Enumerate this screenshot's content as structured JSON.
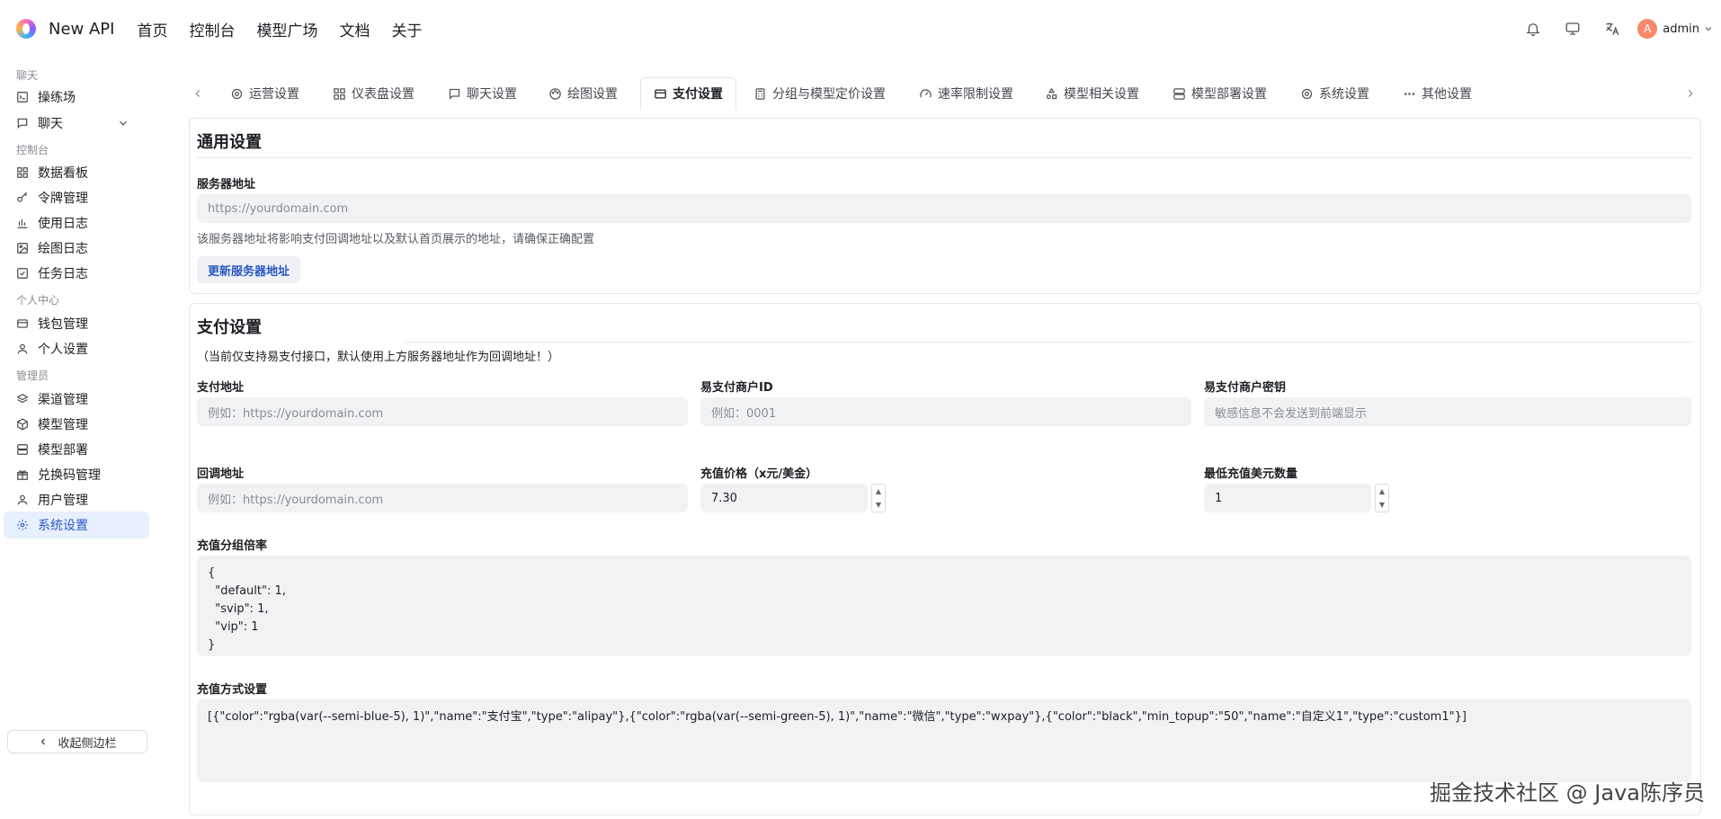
{
  "app": {
    "brand": "New API"
  },
  "nav": {
    "links": [
      "首页",
      "控制台",
      "模型广场",
      "文档",
      "关于"
    ]
  },
  "user": {
    "avatar_letter": "A",
    "name": "admin"
  },
  "sidebar": {
    "groups": [
      {
        "title": "聊天",
        "items": [
          {
            "label": "操练场",
            "icon": "playground-icon"
          },
          {
            "label": "聊天",
            "icon": "chat-icon"
          }
        ]
      },
      {
        "title": "控制台",
        "items": [
          {
            "label": "数据看板",
            "icon": "dashboard-icon"
          },
          {
            "label": "令牌管理",
            "icon": "key-icon"
          },
          {
            "label": "使用日志",
            "icon": "bar-chart-icon"
          },
          {
            "label": "绘图日志",
            "icon": "image-icon"
          },
          {
            "label": "任务日志",
            "icon": "checkbox-icon"
          }
        ]
      },
      {
        "title": "个人中心",
        "items": [
          {
            "label": "钱包管理",
            "icon": "wallet-icon"
          },
          {
            "label": "个人设置",
            "icon": "user-icon"
          }
        ]
      },
      {
        "title": "管理员",
        "items": [
          {
            "label": "渠道管理",
            "icon": "layers-icon"
          },
          {
            "label": "模型管理",
            "icon": "cube-icon"
          },
          {
            "label": "模型部署",
            "icon": "server-icon"
          },
          {
            "label": "兑换码管理",
            "icon": "gift-icon"
          },
          {
            "label": "用户管理",
            "icon": "user-icon"
          },
          {
            "label": "系统设置",
            "icon": "gear-icon"
          }
        ]
      }
    ],
    "collapse_label": "收起侧边栏"
  },
  "tabs": [
    {
      "label": "运营设置",
      "icon": "gear-icon"
    },
    {
      "label": "仪表盘设置",
      "icon": "dashboard-icon"
    },
    {
      "label": "聊天设置",
      "icon": "chat-icon"
    },
    {
      "label": "绘图设置",
      "icon": "palette-icon"
    },
    {
      "label": "支付设置",
      "icon": "card-icon",
      "active": true
    },
    {
      "label": "分组与模型定价设置",
      "icon": "calculator-icon"
    },
    {
      "label": "速率限制设置",
      "icon": "gauge-icon"
    },
    {
      "label": "模型相关设置",
      "icon": "shapes-icon"
    },
    {
      "label": "模型部署设置",
      "icon": "server-icon"
    },
    {
      "label": "系统设置",
      "icon": "gear-icon"
    },
    {
      "label": "其他设置",
      "icon": "more-icon"
    }
  ],
  "general": {
    "title": "通用设置",
    "server_label": "服务器地址",
    "server_placeholder": "https://yourdomain.com",
    "server_hint": "该服务器地址将影响支付回调地址以及默认首页展示的地址，请确保正确配置",
    "update_button": "更新服务器地址"
  },
  "payment": {
    "title": "支付设置",
    "note": "（当前仅支持易支付接口，默认使用上方服务器地址作为回调地址！）",
    "pay_url_label": "支付地址",
    "pay_url_placeholder": "例如：https://yourdomain.com",
    "merchant_id_label": "易支付商户ID",
    "merchant_id_placeholder": "例如：0001",
    "merchant_key_label": "易支付商户密钥",
    "merchant_key_placeholder": "敏感信息不会发送到前端显示",
    "callback_label": "回调地址",
    "callback_placeholder": "例如：https://yourdomain.com",
    "price_label": "充值价格（x元/美金）",
    "price_value": "7.30",
    "min_topup_label": "最低充值美元数量",
    "min_topup_value": "1",
    "group_ratio_label": "充值分组倍率",
    "group_ratio_value": "{\n  \"default\": 1,\n  \"svip\": 1,\n  \"vip\": 1\n}",
    "methods_label": "充值方式设置",
    "methods_value": "[{\"color\":\"rgba(var(--semi-blue-5), 1)\",\"name\":\"支付宝\",\"type\":\"alipay\"},{\"color\":\"rgba(var(--semi-green-5), 1)\",\"name\":\"微信\",\"type\":\"wxpay\"},{\"color\":\"black\",\"min_topup\":\"50\",\"name\":\"自定义1\",\"type\":\"custom1\"}]"
  },
  "watermark": "掘金技术社区 @ Java陈序员"
}
